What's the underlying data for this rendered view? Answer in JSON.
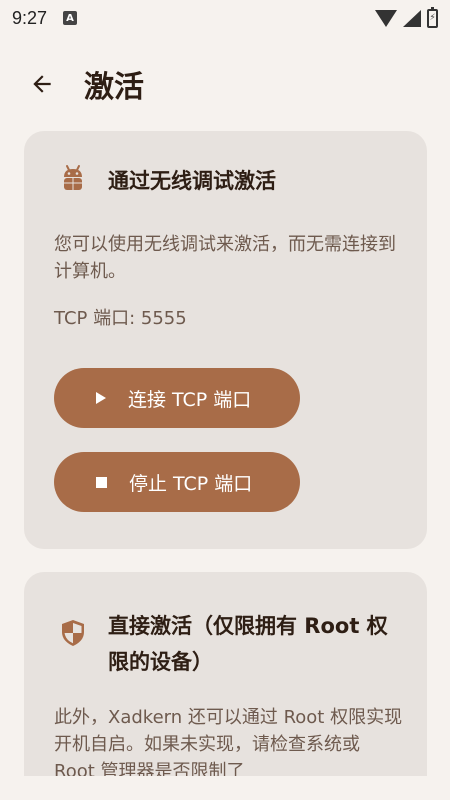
{
  "status_bar": {
    "time": "9:27",
    "notification_badge": "A",
    "battery_indicator": "⚡"
  },
  "app_bar": {
    "title": "激活",
    "back_icon": "arrow-back-icon"
  },
  "wireless_card": {
    "icon": "android-icon",
    "title": "通过无线调试激活",
    "description": "您可以使用无线调试来激活，而无需连接到计算机。",
    "tcp_port_text": "TCP 端口: 5555",
    "connect_button": {
      "icon": "play-icon",
      "label": "连接 TCP 端口"
    },
    "stop_button": {
      "icon": "stop-icon",
      "label": "停止 TCP 端口"
    }
  },
  "root_card": {
    "icon": "shield-icon",
    "title": "直接激活（仅限拥有 Root 权限的设备）",
    "description": "此外，Xadkern 还可以通过 Root 权限实现开机自启。如果未实现，请检查系统或 Root 管理器是否限制了"
  },
  "colors": {
    "background": "#f6f2ee",
    "card": "#e7e2de",
    "accent": "#a86c48",
    "title_text": "#2e1e14",
    "body_text": "#6e5a4e"
  }
}
